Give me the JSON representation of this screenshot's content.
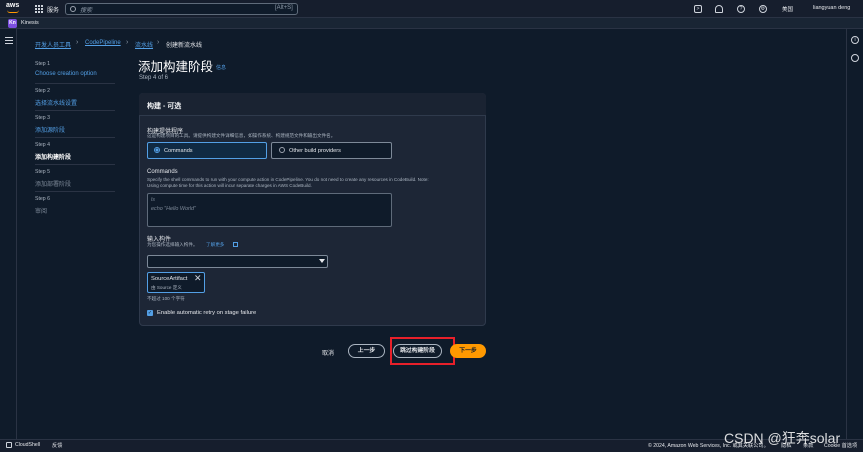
{
  "header": {
    "logo": "aws",
    "services_label": "服务",
    "search_placeholder": "搜索",
    "search_shortcut": "[Alt+S]",
    "region": "美国",
    "user": "liangyuan deng"
  },
  "service_bar": {
    "badge": "Kn",
    "service_name": "Kinesis"
  },
  "breadcrumb": {
    "items": [
      "开发人员工具",
      "CodePipeline",
      "流水线",
      "创建新流水线"
    ]
  },
  "steps": [
    {
      "num": "Step 1",
      "label": "Choose creation option",
      "state": "done"
    },
    {
      "num": "Step 2",
      "label": "选择流水线设置",
      "state": "done"
    },
    {
      "num": "Step 3",
      "label": "添加源阶段",
      "state": "done"
    },
    {
      "num": "Step 4",
      "label": "添加构建阶段",
      "state": "current"
    },
    {
      "num": "Step 5",
      "label": "添加部署阶段",
      "state": "todo"
    },
    {
      "num": "Step 6",
      "label": "审阅",
      "state": "todo"
    }
  ],
  "page": {
    "title": "添加构建阶段",
    "info_link": "信息",
    "step_of": "Step 4 of 6"
  },
  "form": {
    "section_title": "构建 - 可选",
    "provider": {
      "label": "构建提供程序",
      "description": "这是构建项目的工具。请提供构建文件详细信息，如操作系统、构建规范文件和输出文件名。",
      "options": [
        "Commands",
        "Other build providers"
      ],
      "selected": "Commands"
    },
    "commands": {
      "label": "Commands",
      "description_1": "Specify the shell commands to run with your compute action in CodePipeline. You do not need to create any resources in CodeBuild. Note:",
      "description_2": "Using compute time for this action will incur separate charges in AWS CodeBuild.",
      "placeholder_1": "ls",
      "placeholder_2": "echo \"Hello World\""
    },
    "input_artifacts": {
      "label": "输入构件",
      "description": "为您操作选择输入构件。",
      "learn_more": "了解更多",
      "selected_value": "",
      "token_name": "SourceArtifact",
      "token_sub": "由 Source 定义",
      "limit_note": "不超过 100 个字符"
    },
    "retry": {
      "label": "Enable automatic retry on stage failure",
      "checked": true
    }
  },
  "actions": {
    "cancel": "取消",
    "previous": "上一步",
    "skip": "跳过构建阶段",
    "next": "下一步"
  },
  "footer": {
    "cloudshell": "CloudShell",
    "feedback": "反馈",
    "copyright": "© 2024, Amazon Web Services, Inc. 或其关联公司。",
    "privacy": "隐私",
    "terms": "条款",
    "cookie": "Cookie 首选项"
  },
  "watermark": "CSDN @狂奔solar",
  "colors": {
    "accent": "#539fe5",
    "primary_button": "#ff9900",
    "highlight": "#e8202a",
    "background": "#0f1b2a"
  }
}
